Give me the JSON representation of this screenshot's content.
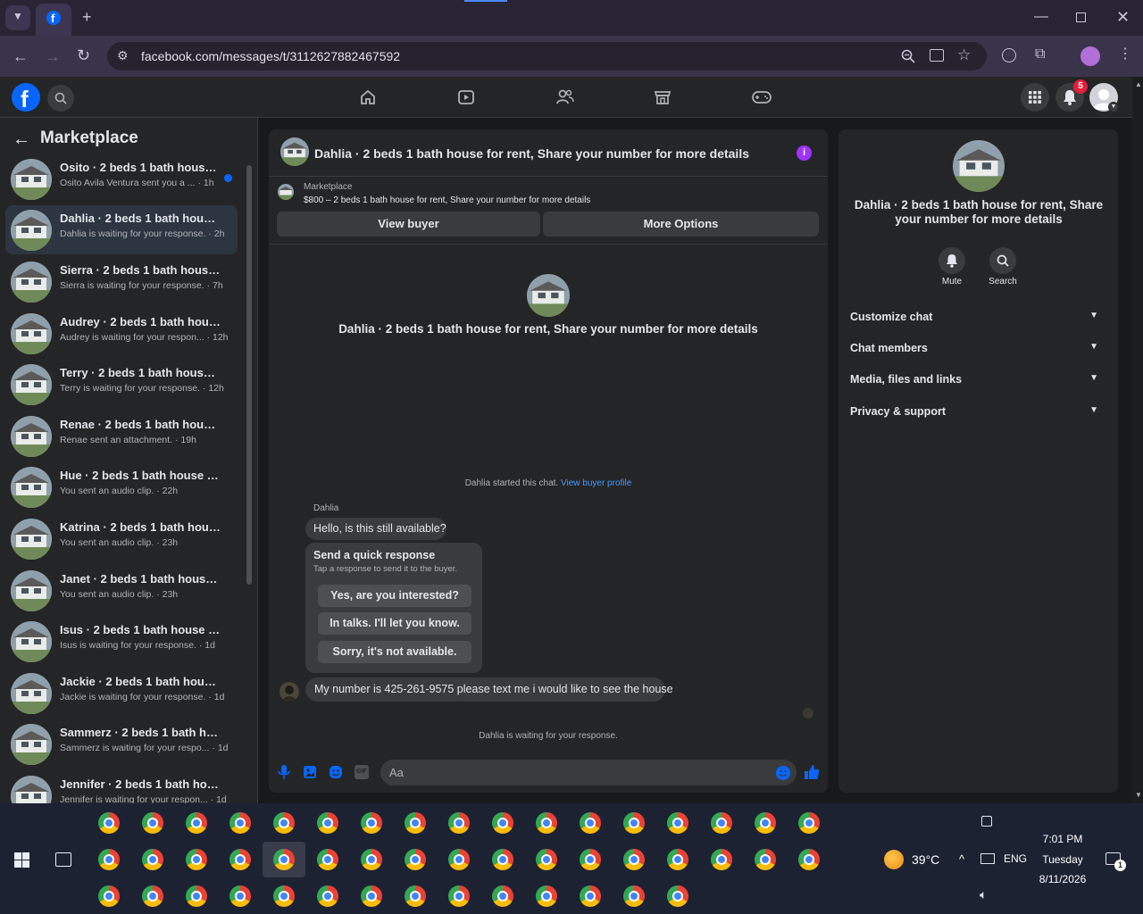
{
  "browser": {
    "url": "facebook.com/messages/t/3112627882467592"
  },
  "header": {
    "notification_count": "5"
  },
  "sidebar": {
    "title": "Marketplace",
    "conversations": [
      {
        "title": "Osito · 2 beds 1 bath house fo...",
        "preview": "Osito Avila Ventura sent you a ...",
        "time": "· 1h",
        "unread": true
      },
      {
        "title": "Dahlia · 2 beds 1 bath house for...",
        "preview": "Dahlia is waiting for your response.",
        "time": "· 2h",
        "active": true
      },
      {
        "title": "Sierra · 2 beds 1 bath house for ...",
        "preview": "Sierra is waiting for your response.",
        "time": "· 7h"
      },
      {
        "title": "Audrey · 2 beds 1 bath house fo...",
        "preview": "Audrey is waiting for your respon...",
        "time": "· 12h"
      },
      {
        "title": "Terry · 2 beds 1 bath house for r...",
        "preview": "Terry is waiting for your response.",
        "time": "· 12h"
      },
      {
        "title": "Renae · 2 beds 1 bath house for ...",
        "preview": "Renae sent an attachment.",
        "time": "· 19h"
      },
      {
        "title": "Hue · 2 beds 1 bath house for re...",
        "preview": "You sent an audio clip.",
        "time": "· 22h"
      },
      {
        "title": "Katrina · 2 beds 1 bath house ...",
        "preview": "You sent an audio clip.",
        "time": "· 23h"
      },
      {
        "title": "Janet · 2 beds 1 bath house fo...",
        "preview": "You sent an audio clip.",
        "time": "· 23h"
      },
      {
        "title": "Isus · 2 beds 1 bath house for re...",
        "preview": "Isus is waiting for your response.",
        "time": "· 1d"
      },
      {
        "title": "Jackie · 2 beds 1 bath house for ...",
        "preview": "Jackie is waiting for your response.",
        "time": "· 1d"
      },
      {
        "title": "Sammerz · 2 beds 1 bath house ...",
        "preview": "Sammerz is waiting for your respo...",
        "time": "· 1d"
      },
      {
        "title": "Jennifer · 2 beds 1 bath house f...",
        "preview": "Jennifer is waiting for your respon...",
        "time": "· 1d"
      }
    ]
  },
  "chat": {
    "title": "Dahlia · 2 beds 1 bath house for rent, Share your number for more details",
    "listing_source": "Marketplace",
    "listing_line": "$800 – 2 beds 1 bath house for rent, Share your number for more details",
    "view_buyer_label": "View buyer",
    "more_options_label": "More Options",
    "intro_title": "Dahlia · 2 beds 1 bath house for rent, Share your number for more details",
    "started_text": "Dahlia started this chat.",
    "view_profile_link": "View buyer profile",
    "sender_name": "Dahlia",
    "msg1": "Hello, is this still available?",
    "quick_title": "Send a quick response",
    "quick_sub": "Tap a response to send it to the buyer.",
    "quick_options": [
      "Yes, are you interested?",
      "In talks. I'll let you know.",
      "Sorry, it's not available."
    ],
    "msg2": "My number is 425-261-9575 please text me i would like to see the house",
    "waiting_text": "Dahlia is waiting for your response.",
    "composer_placeholder": "Aa"
  },
  "details": {
    "title": "Dahlia · 2 beds 1 bath house for rent, Share your number for more details",
    "mute_label": "Mute",
    "search_label": "Search",
    "sections": [
      "Customize chat",
      "Chat members",
      "Media, files and links",
      "Privacy & support"
    ]
  },
  "taskbar": {
    "weather": "39°C",
    "lang": "ENG",
    "time": "7:01 PM",
    "day": "Tuesday",
    "date": "8/11/2026",
    "notif_count": "1"
  },
  "colors": {
    "accent": "#0866ff",
    "link": "#4599ff",
    "info_purple": "#a033ff",
    "badge_red": "#e41e3f"
  }
}
